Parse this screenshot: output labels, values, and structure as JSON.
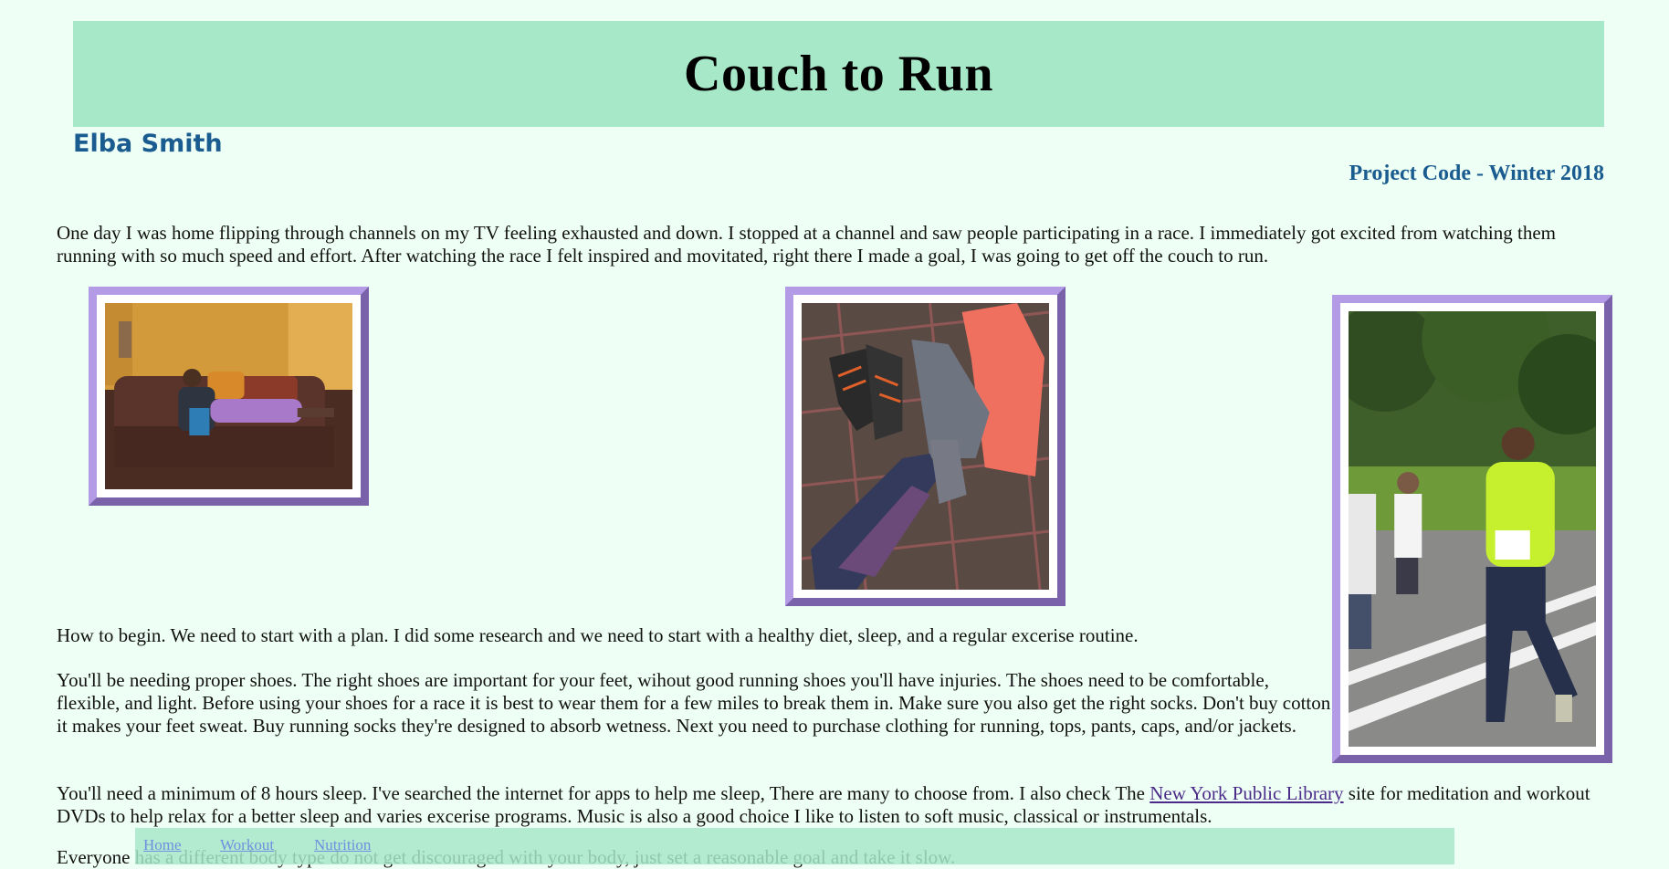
{
  "header": {
    "title": "Couch to Run",
    "author": "Elba Smith",
    "project_code": "Project Code - Winter 2018"
  },
  "intro": "One day I was home flipping through channels on my TV feeling exhausted and down. I stopped at a channel and saw people participating in a race. I immediately got excited from watching them running with so much speed and effort. After watching the race I felt inspired and movitated, right there I made a goal, I was going to get off the couch to run.",
  "images": [
    {
      "name": "couch-photo",
      "alt": "Woman relaxing on a couch"
    },
    {
      "name": "gear-photo",
      "alt": "Running shoes and clothes laid on a bed"
    },
    {
      "name": "race-photo",
      "alt": "Runner in a race"
    }
  ],
  "paragraphs": {
    "begin": "How to begin. We need to start with a plan. I did some research and we need to start with a healthy diet, sleep, and a regular excerise routine.",
    "shoes": "You'll be needing proper shoes. The right shoes are important for your feet, wihout good running shoes you'll have injuries. The shoes need to be comfortable, flexible, and light. Before using your shoes for a race it is best to wear them for a few miles to break them in. Make sure you also get the right socks. Don't buy cotton it makes your feet sweat. Buy running socks they're designed to absorb wetness. Next you need to purchase clothing for running, tops, pants, caps, and/or jackets.",
    "sleep_before": "You'll need a minimum of 8 hours sleep. I've searched the internet for apps to help me sleep, There are many to choose from. I also check The ",
    "sleep_link": "New York Public Library",
    "sleep_after": " site for meditation and workout DVDs to help relax for a better sleep and varies excerise programs. Music is also a good choice I like to listen to soft music, classical or instrumentals.",
    "body_type": "Everyone has a different body type do not get discouraged with your body, just set a reasonable goal and take it slow."
  },
  "nav": {
    "home": "Home",
    "workout": "Workout",
    "nutrition": "Nutrition"
  }
}
